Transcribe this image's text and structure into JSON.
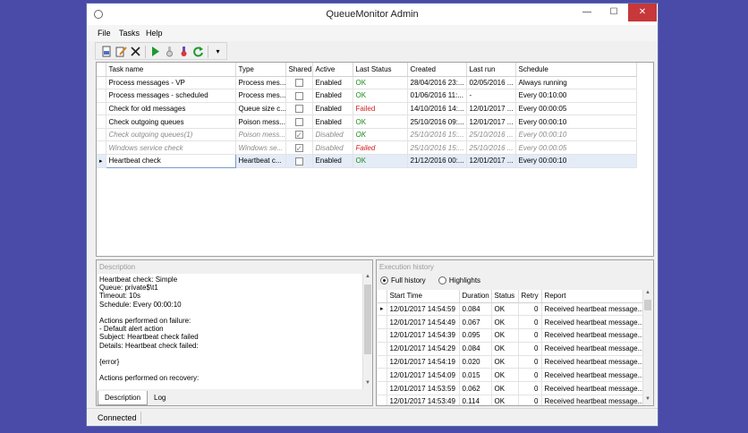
{
  "window": {
    "title": "QueueMonitor Admin",
    "minimize": "—",
    "maximize": "☐",
    "close": "✕"
  },
  "menu": [
    "File",
    "Tasks",
    "Help"
  ],
  "toolbar": {
    "dropdown": "▾"
  },
  "tasks_grid": {
    "columns": [
      "Task name",
      "Type",
      "Shared",
      "Active",
      "Last Status",
      "Created",
      "Last run",
      "Schedule"
    ],
    "current_row_marker": "▸",
    "rows": [
      {
        "name": "Process messages - VP",
        "type": "Process mes...",
        "shared": false,
        "active": "Enabled",
        "status": "OK",
        "created": "28/04/2016 23:...",
        "last_run": "02/05/2016 ...",
        "schedule": "Always running"
      },
      {
        "name": "Process messages - scheduled",
        "type": "Process mes...",
        "shared": false,
        "active": "Enabled",
        "status": "OK",
        "created": "01/06/2016 11:...",
        "last_run": "-",
        "schedule": "Every 00:10:00"
      },
      {
        "name": "Check for old messages",
        "type": "Queue size c...",
        "shared": false,
        "active": "Enabled",
        "status": "Failed",
        "created": "14/10/2016 14:...",
        "last_run": "12/01/2017 ...",
        "schedule": "Every 00:00:05"
      },
      {
        "name": "Check outgoing queues",
        "type": "Poison mess...",
        "shared": false,
        "active": "Enabled",
        "status": "OK",
        "created": "25/10/2016 09:...",
        "last_run": "12/01/2017 ...",
        "schedule": "Every 00:00:10"
      },
      {
        "name": "Check outgoing queues(1)",
        "type": "Poison mess...",
        "shared": true,
        "active": "Disabled",
        "status": "OK",
        "created": "25/10/2016 15:...",
        "last_run": "25/10/2016 ...",
        "schedule": "Every 00:00:10"
      },
      {
        "name": "Windows service check",
        "type": "Windows se...",
        "shared": true,
        "active": "Disabled",
        "status": "Failed",
        "created": "25/10/2016 15:...",
        "last_run": "25/10/2016 ...",
        "schedule": "Every 00:00:05"
      },
      {
        "name": "Heartbeat check",
        "type": "Heartbeat c...",
        "shared": false,
        "active": "Enabled",
        "status": "OK",
        "created": "21/12/2016 00:...",
        "last_run": "12/01/2017 ...",
        "schedule": "Every 00:00:10"
      }
    ]
  },
  "description": {
    "title": "Description",
    "lines": [
      "Heartbeat check: Simple",
      "Queue: private$\\t1",
      "Timeout: 10s",
      "Schedule: Every 00:00:10",
      "",
      "Actions performed on failure:",
      "- Default alert action",
      "Subject: Heartbeat check failed",
      "Details: Heartbeat check failed:",
      "",
      "{error}",
      "",
      "Actions performed on recovery:"
    ],
    "tabs": [
      "Description",
      "Log"
    ],
    "scroll_up": "▲",
    "scroll_down": "▼"
  },
  "execution_history": {
    "title": "Execution history",
    "options": [
      "Full history",
      "Highlights"
    ],
    "selected_option": "Full history",
    "columns": [
      "Start Time",
      "Duration",
      "Status",
      "Retry",
      "Report"
    ],
    "current_row_marker": "▸",
    "rows": [
      {
        "start": "12/01/2017 14:54:59",
        "duration": "0.084",
        "status": "OK",
        "retry": "0",
        "report": "Received heartbeat message..."
      },
      {
        "start": "12/01/2017 14:54:49",
        "duration": "0.067",
        "status": "OK",
        "retry": "0",
        "report": "Received heartbeat message..."
      },
      {
        "start": "12/01/2017 14:54:39",
        "duration": "0.095",
        "status": "OK",
        "retry": "0",
        "report": "Received heartbeat message..."
      },
      {
        "start": "12/01/2017 14:54:29",
        "duration": "0.084",
        "status": "OK",
        "retry": "0",
        "report": "Received heartbeat message..."
      },
      {
        "start": "12/01/2017 14:54:19",
        "duration": "0.020",
        "status": "OK",
        "retry": "0",
        "report": "Received heartbeat message..."
      },
      {
        "start": "12/01/2017 14:54:09",
        "duration": "0.015",
        "status": "OK",
        "retry": "0",
        "report": "Received heartbeat message..."
      },
      {
        "start": "12/01/2017 14:53:59",
        "duration": "0.062",
        "status": "OK",
        "retry": "0",
        "report": "Received heartbeat message..."
      },
      {
        "start": "12/01/2017 14:53:49",
        "duration": "0.114",
        "status": "OK",
        "retry": "0",
        "report": "Received heartbeat message..."
      }
    ],
    "scroll_up": "▲",
    "scroll_down": "▼"
  },
  "statusbar": {
    "text": "Connected"
  },
  "colors": {
    "desktop": "#4a4aa8",
    "status_ok": "#1a8a1a",
    "status_failed": "#d42020",
    "close_button": "#c7383a",
    "selected_row": "#e4ecf8"
  }
}
